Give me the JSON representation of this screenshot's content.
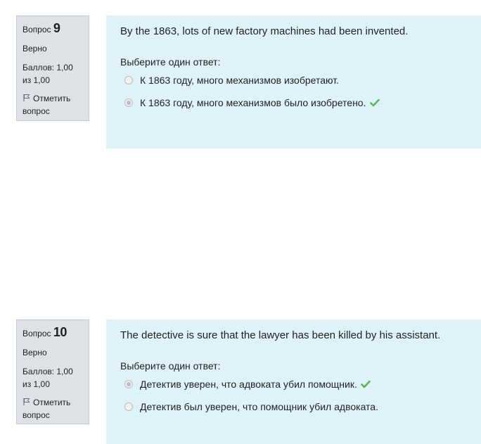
{
  "questions": [
    {
      "label": "Вопрос",
      "number": "9",
      "state": "Верно",
      "grade": "Баллов: 1,00 из 1,00",
      "flag": "Отметить вопрос",
      "text": "By the 1863, lots of new factory machines had been invented.",
      "prompt": "Выберите один ответ:",
      "answers": [
        {
          "text": "К 1863 году, много механизмов изобретают.",
          "selected": false,
          "correct": false
        },
        {
          "text": "К 1863 году, много механизмов было изобретено.",
          "selected": true,
          "correct": true
        }
      ]
    },
    {
      "label": "Вопрос",
      "number": "10",
      "state": "Верно",
      "grade": "Баллов: 1,00 из 1,00",
      "flag": "Отметить вопрос",
      "text": "The detective is sure that the lawyer has been killed by his assistant.",
      "prompt": "Выберите один ответ:",
      "answers": [
        {
          "text": "Детектив уверен, что адвоката убил помощник.",
          "selected": true,
          "correct": true
        },
        {
          "text": "Детектив был уверен, что помощник убил адвоката.",
          "selected": false,
          "correct": false
        }
      ]
    }
  ],
  "colors": {
    "info_bg": "#dee2e6",
    "content_bg": "#def2f8",
    "correct": "#5bb55b"
  },
  "icons": {
    "flag": "flag-icon",
    "correct": "check-icon"
  }
}
